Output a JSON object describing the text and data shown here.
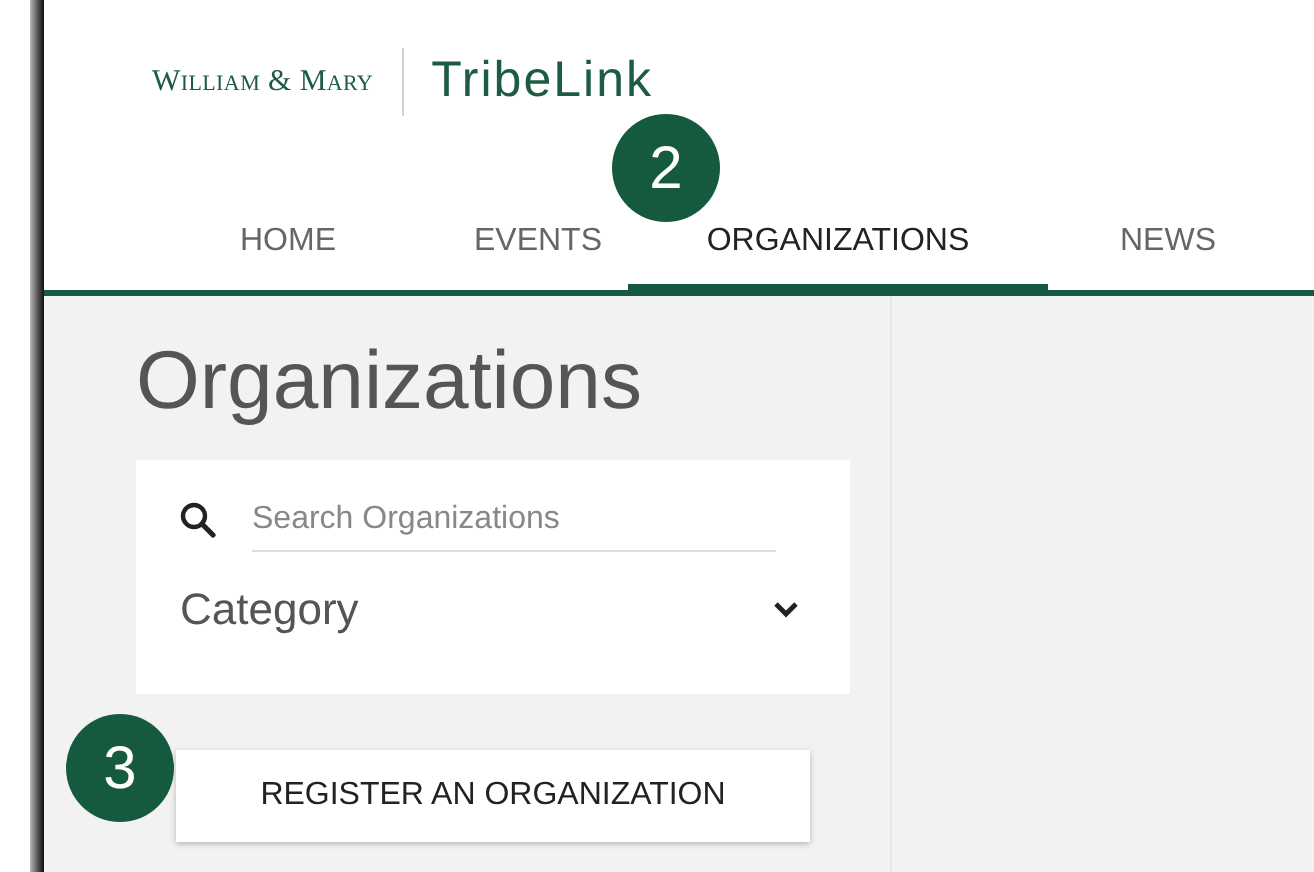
{
  "header": {
    "wordmark": "William & Mary",
    "product": "TribeLink"
  },
  "nav": [
    {
      "label": "HOME",
      "selected": false
    },
    {
      "label": "EVENTS",
      "selected": false
    },
    {
      "label": "ORGANIZATIONS",
      "selected": true
    },
    {
      "label": "NEWS",
      "selected": false
    }
  ],
  "page_title": "Organizations",
  "search": {
    "placeholder": "Search Organizations"
  },
  "category": {
    "label": "Category"
  },
  "register_button": "REGISTER AN ORGANIZATION",
  "callouts": [
    {
      "label": "2"
    },
    {
      "label": "3"
    }
  ]
}
